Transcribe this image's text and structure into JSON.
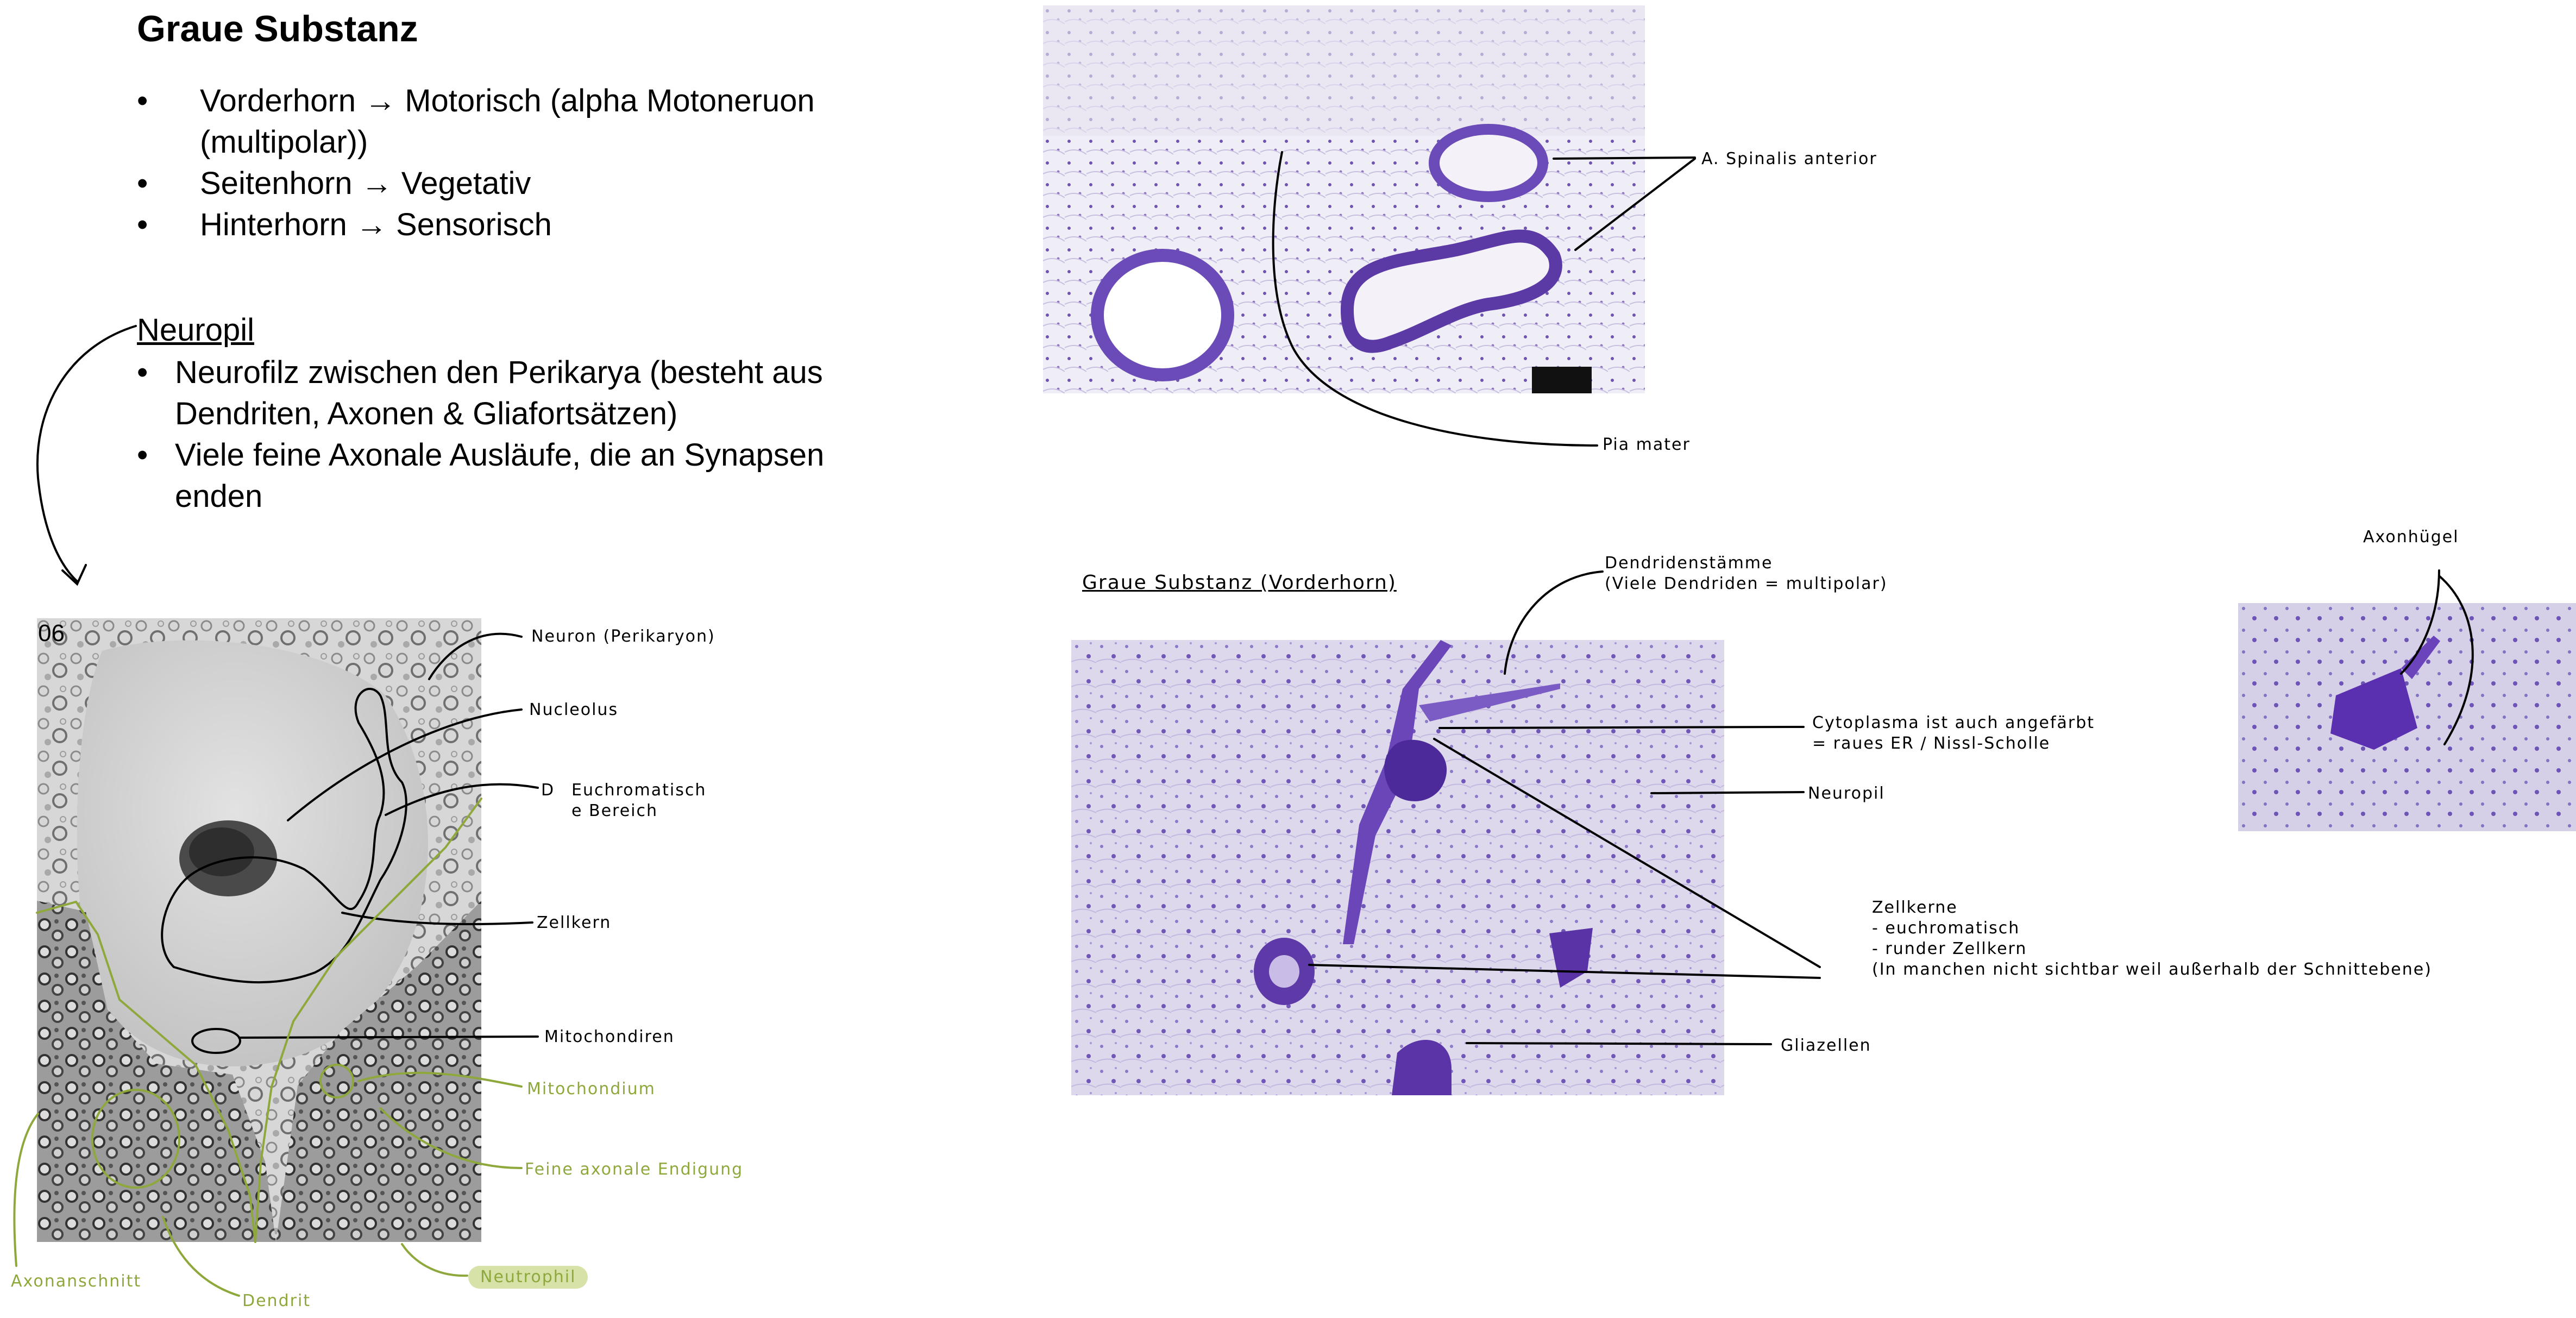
{
  "title": "Graue Substanz",
  "horn_bullets": [
    {
      "line1": "Vorderhorn → Motorisch (alpha Motoneruon",
      "line2": "(multipolar))"
    },
    {
      "line1": "Seitenhorn → Vegetativ"
    },
    {
      "line1": "Hinterhorn → Sensorisch"
    }
  ],
  "bullet_char": "•",
  "neuropil": {
    "heading": "Neuropil",
    "bullets": [
      {
        "line1": "Neurofilz zwischen den Perikarya (besteht aus",
        "line2": "Dendriten, Axonen & Gliafortsätzen)"
      },
      {
        "line1": "Viele feine Axonale Ausläufe, die an Synapsen",
        "line2": "enden"
      }
    ]
  },
  "em_figure": {
    "number": "06",
    "labels": {
      "neuron": "Neuron (Perikaryon)",
      "nucleolus": "Nucleolus",
      "euchromatisch_marker": "D",
      "euchromatisch": "Euchromatisch\ne Bereich",
      "zellkern": "Zellkern",
      "mitochondiren": "Mitochondiren",
      "mitochondium": "Mitochondium",
      "axonale_endigung": "Feine axonale Endigung",
      "neutrophil": "Neutrophil",
      "axonanschnitt": "Axonanschnitt",
      "dendrit": "Dendrit"
    }
  },
  "vessel_figure": {
    "labels": {
      "spinalis": "A. Spinalis anterior",
      "pia": "Pia mater"
    }
  },
  "vorderhorn_figure": {
    "heading": "Graue Substanz (Vorderhorn)",
    "labels": {
      "dendriden": "Dendridenstämme\n(Viele Dendriden = multipolar)",
      "cytoplasma": "Cytoplasma ist auch angefärbt\n= raues ER / Nissl-Scholle",
      "neuropil": "Neuropil",
      "zellkerne": "Zellkerne\n- euchromatisch\n- runder Zellkern\n(In manchen nicht sichtbar weil außerhalb der Schnittebene)",
      "gliazellen": "Gliazellen",
      "axonhuegel": "Axonhügel"
    }
  },
  "colors": {
    "annotation_green": "#8ea83c",
    "stain_purple": "#7a5cc0",
    "em_gray": "#9a9a9a"
  }
}
